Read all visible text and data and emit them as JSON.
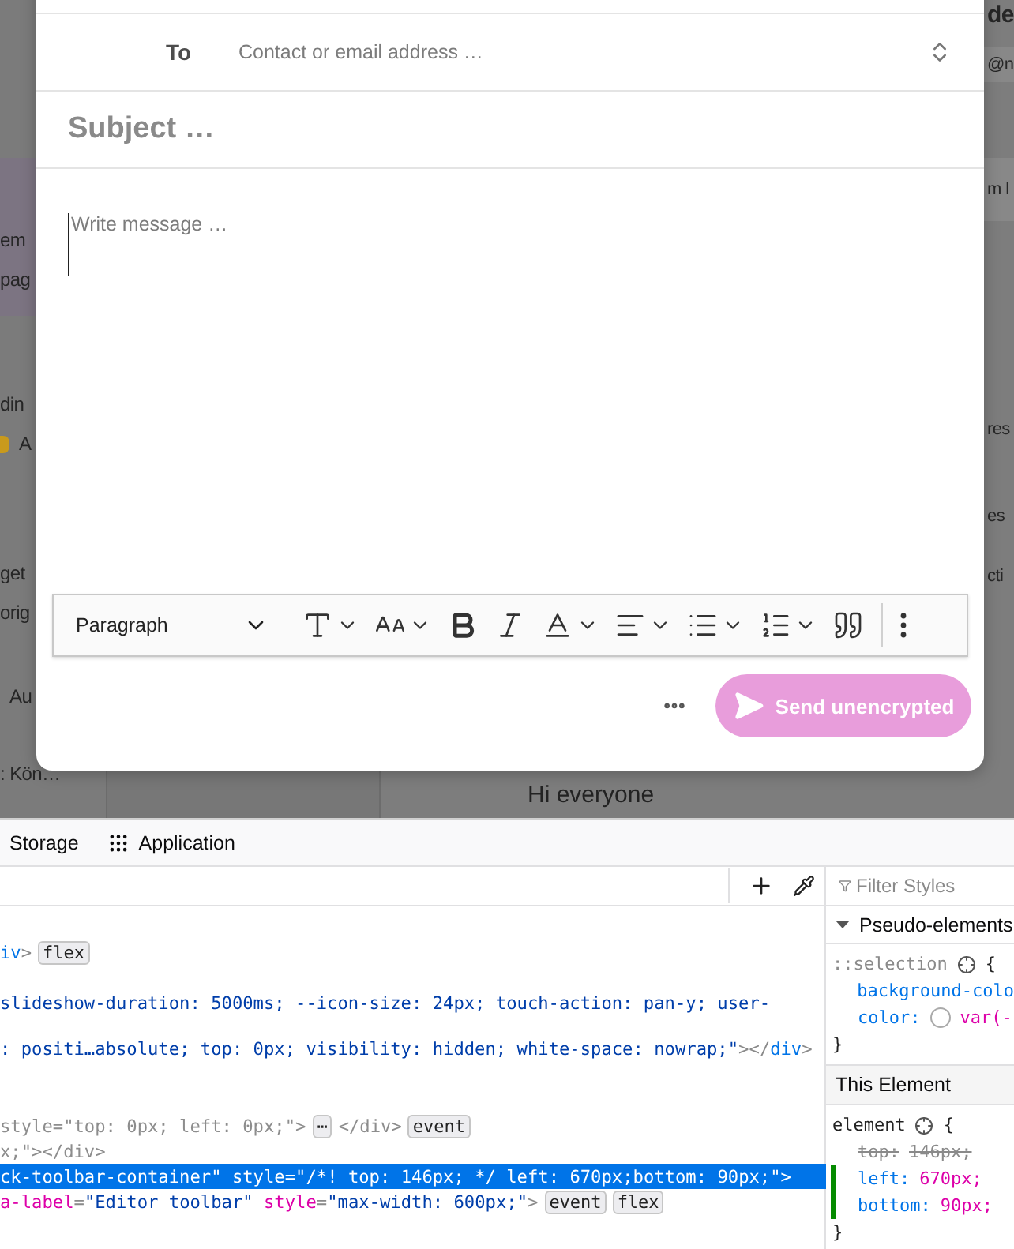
{
  "backdrop": {
    "left_band": [
      "em",
      "pag"
    ],
    "left_items": [
      {
        "kind": "text",
        "text": "din"
      },
      {
        "kind": "emoji",
        "text": "A"
      },
      {
        "kind": "text",
        "text": "get"
      },
      {
        "kind": "text",
        "text": "orig"
      },
      {
        "kind": "text",
        "text": "Au"
      },
      {
        "kind": "text",
        "text": ": Kön…"
      }
    ],
    "right_items": [
      {
        "kind": "heading",
        "text": "de"
      },
      {
        "kind": "band",
        "text": "@n"
      },
      {
        "kind": "band",
        "text": "m l"
      },
      {
        "kind": "text",
        "text": "res"
      },
      {
        "kind": "text",
        "text": "es"
      },
      {
        "kind": "text",
        "text": "cti"
      }
    ],
    "message_preview": "Hi everyone"
  },
  "composer": {
    "to_label": "To",
    "to_placeholder": "Contact or email address …",
    "subject_placeholder": "Subject …",
    "body_placeholder": "Write message …",
    "toolbar": [
      {
        "kind": "heading-dropdown",
        "label": "Paragraph",
        "has_menu": true
      },
      {
        "kind": "font-family",
        "has_menu": true
      },
      {
        "kind": "font-size",
        "has_menu": true
      },
      {
        "kind": "bold",
        "has_menu": false
      },
      {
        "kind": "italic",
        "has_menu": false
      },
      {
        "kind": "font-color",
        "has_menu": true
      },
      {
        "kind": "align",
        "has_menu": true
      },
      {
        "kind": "bulleted-list",
        "has_menu": true
      },
      {
        "kind": "numbered-list",
        "has_menu": true
      },
      {
        "kind": "blockquote",
        "has_menu": false
      },
      {
        "kind": "separator"
      },
      {
        "kind": "more",
        "has_menu": false
      }
    ],
    "send_button": "Send unencrypted"
  },
  "devtools": {
    "tabs": [
      {
        "kind": "plain",
        "label": "Storage"
      },
      {
        "kind": "grid",
        "label": "Application"
      }
    ],
    "code_lines": [
      {
        "selected": false,
        "segments": [
          {
            "kind": "code",
            "parts": [
              {
                "kind": "tag",
                "text": "iv"
              },
              {
                "kind": "punct",
                "text": ">"
              }
            ]
          },
          {
            "kind": "badge",
            "text": "flex"
          }
        ]
      },
      {
        "selected": false,
        "segments": [
          {
            "kind": "code",
            "parts": [
              {
                "kind": "value",
                "text": "slideshow-duration: 5000ms; --icon-size: 24px; touch-action: pan-y; user-"
              }
            ]
          }
        ]
      },
      {
        "selected": false,
        "segments": [
          {
            "kind": "code",
            "parts": [
              {
                "kind": "value",
                "text": ": positi…absolute; top: 0px; visibility: hidden; white-space: nowrap;\""
              },
              {
                "kind": "punct",
                "text": "></"
              },
              {
                "kind": "tag",
                "text": "div"
              },
              {
                "kind": "punct",
                "text": ">"
              }
            ]
          }
        ]
      },
      {
        "selected": false,
        "segments": [
          {
            "kind": "code",
            "parts": [
              {
                "kind": "muted",
                "text": "style=\"top: 0px; left: 0px;\">"
              }
            ]
          },
          {
            "kind": "badge",
            "text": "⋯"
          },
          {
            "kind": "code",
            "parts": [
              {
                "kind": "muted",
                "text": "</div>"
              }
            ]
          },
          {
            "kind": "badge",
            "text": "event"
          }
        ]
      },
      {
        "selected": false,
        "segments": [
          {
            "kind": "code",
            "parts": [
              {
                "kind": "muted",
                "text": "x;\"></div>"
              }
            ]
          }
        ]
      },
      {
        "selected": true,
        "segments": [
          {
            "kind": "code",
            "parts": [
              {
                "kind": "value",
                "text": "ck-toolbar-container\" "
              },
              {
                "kind": "attr",
                "text": "style"
              },
              {
                "kind": "punct",
                "text": "="
              },
              {
                "kind": "value",
                "text": "\"/*! top: 146px; */ left: 670px;bottom: 90px;\""
              },
              {
                "kind": "punct",
                "text": ">"
              }
            ]
          }
        ]
      },
      {
        "selected": false,
        "segments": [
          {
            "kind": "code",
            "parts": [
              {
                "kind": "attr",
                "text": "a-label"
              },
              {
                "kind": "punct",
                "text": "="
              },
              {
                "kind": "value",
                "text": "\"Editor toolbar\" "
              },
              {
                "kind": "attr",
                "text": "style"
              },
              {
                "kind": "punct",
                "text": "="
              },
              {
                "kind": "value",
                "text": "\"max-width: 600px;\""
              },
              {
                "kind": "punct",
                "text": ">"
              }
            ]
          },
          {
            "kind": "badge",
            "text": "event"
          },
          {
            "kind": "badge",
            "text": "flex"
          }
        ]
      }
    ],
    "styles": {
      "filter_placeholder": "Filter Styles",
      "pseudo_section": {
        "label": "Pseudo-elements",
        "expanded": true,
        "rule": {
          "selector": "::selection",
          "open": "{",
          "close": "}",
          "declarations": [
            {
              "property": "background-colo",
              "overridden": false,
              "changed": false
            },
            {
              "property": "color:",
              "color": "#ffffff",
              "value": "var(-",
              "overridden": false,
              "changed": false
            }
          ]
        }
      },
      "element_section": {
        "label": "This Element",
        "rule": {
          "selector": "element",
          "open": "{",
          "close": "}",
          "declarations": [
            {
              "property": "top:",
              "value": "146px;",
              "overridden": true,
              "changed": false
            },
            {
              "property": "left:",
              "value": "670px;",
              "overridden": false,
              "changed": true
            },
            {
              "property": "bottom:",
              "value": "90px;",
              "overridden": false,
              "changed": true
            }
          ]
        }
      }
    }
  }
}
